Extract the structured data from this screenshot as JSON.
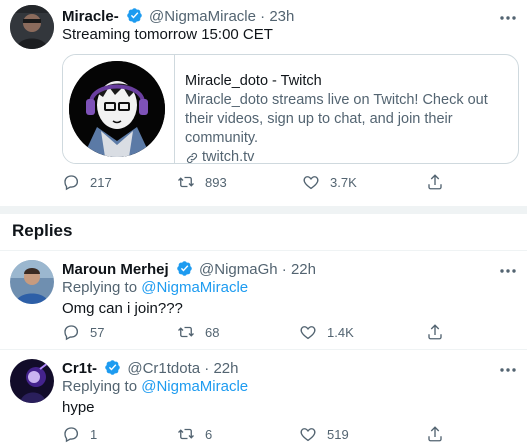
{
  "main_tweet": {
    "name": "Miracle-",
    "handle": "@NigmaMiracle",
    "dot": "·",
    "time": "23h",
    "text": "Streaming tomorrow 15:00 CET",
    "card": {
      "title": "Miracle_doto - Twitch",
      "description": "Miracle_doto streams live on Twitch! Check out their videos, sign up to chat, and join their community.",
      "domain": "twitch.tv"
    },
    "replies": "217",
    "retweets": "893",
    "likes": "3.7K"
  },
  "replies_heading": "Replies",
  "replies": [
    {
      "name": "Maroun Merhej",
      "handle": "@NigmaGh",
      "dot": "·",
      "time": "22h",
      "replying_prefix": "Replying to",
      "replying_to": "@NigmaMiracle",
      "text": "Omg can i join???",
      "replies": "57",
      "retweets": "68",
      "likes": "1.4K"
    },
    {
      "name": "Cr1t-",
      "handle": "@Cr1tdota",
      "dot": "·",
      "time": "22h",
      "replying_prefix": "Replying to",
      "replying_to": "@NigmaMiracle",
      "text": "hype",
      "replies": "1",
      "retweets": "6",
      "likes": "519"
    }
  ],
  "colors": {
    "verified": "#1d9bf0",
    "link": "#1d9bf0",
    "secondary_text": "#536471",
    "border": "#cfd9de"
  },
  "icons": [
    "verified-badge-icon",
    "more-icon",
    "reply-icon",
    "retweet-icon",
    "like-icon",
    "share-icon",
    "link-icon"
  ]
}
